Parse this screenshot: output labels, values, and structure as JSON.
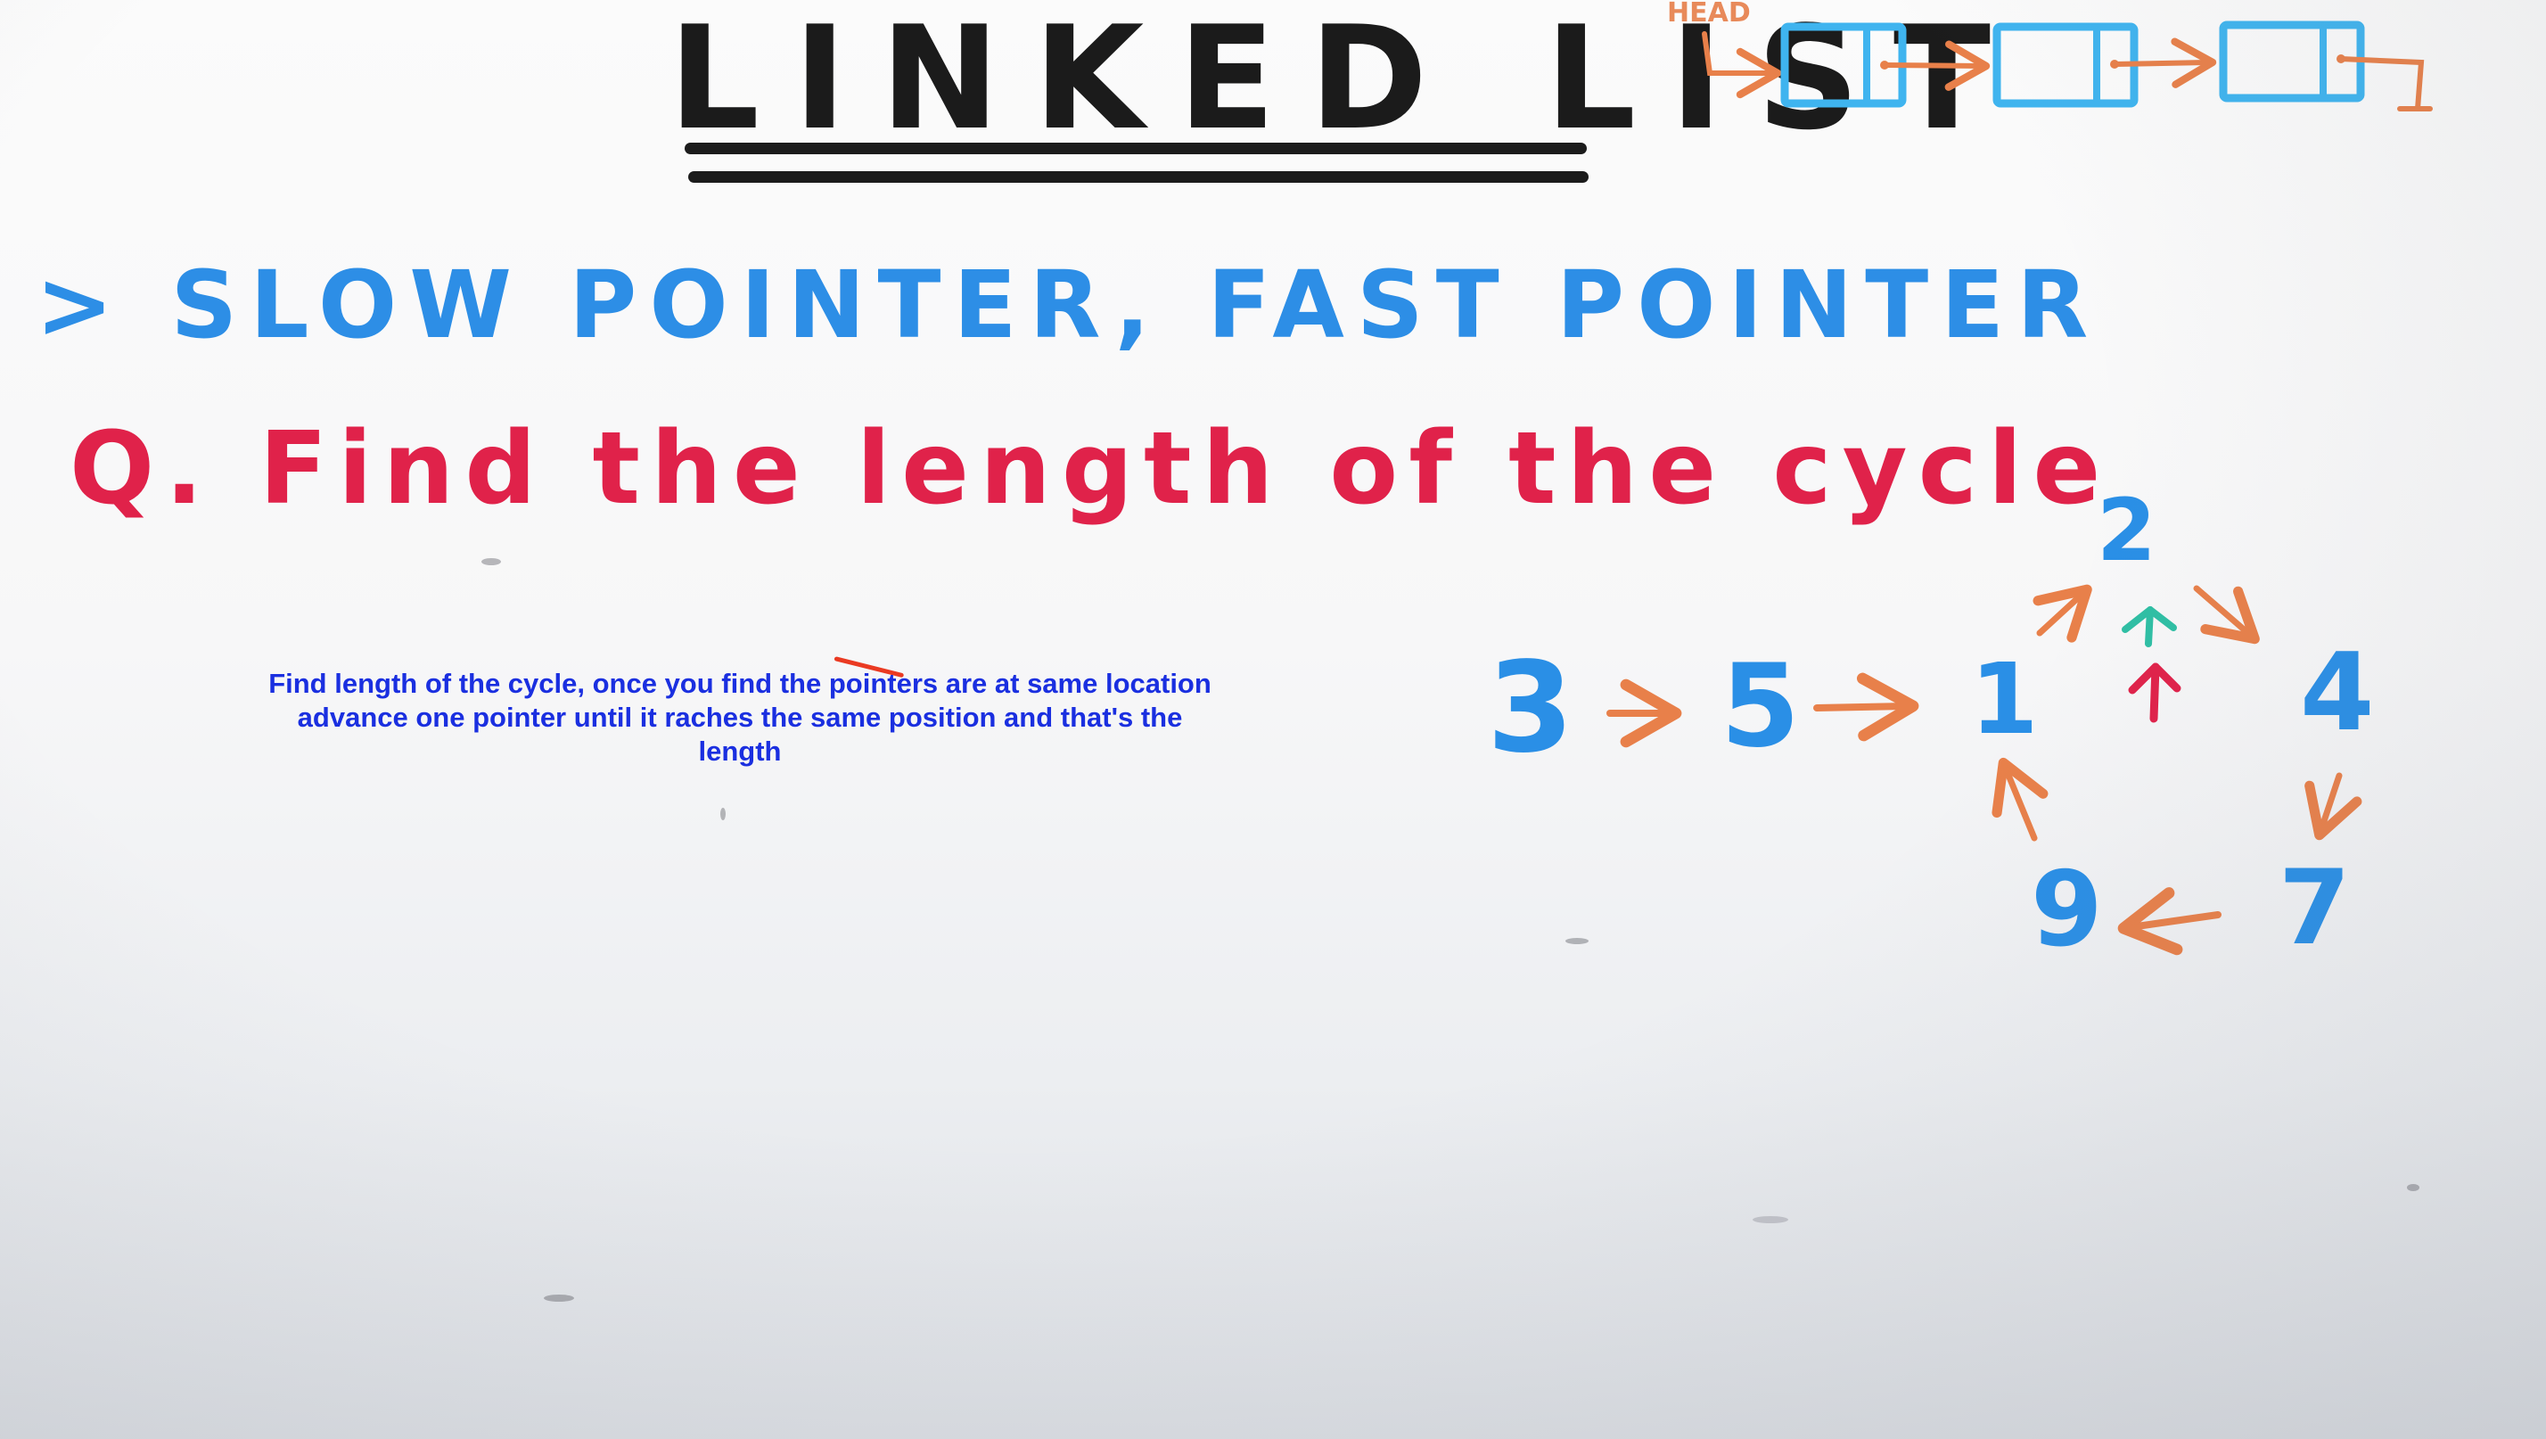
{
  "board": {
    "title": "LINKED LIST",
    "bullet": "> SLOW POINTER, FAST POINTER",
    "question": "Q. Find the length of the cycle"
  },
  "caption": {
    "text": "Find length of the cycle, once you find the pointers are at same location advance one pointer until it raches the same position and that's the length"
  },
  "header_diagram": {
    "head_label": "HEAD"
  },
  "cycle_diagram": {
    "nodes": [
      "3",
      "5",
      "1",
      "2",
      "4",
      "7",
      "9"
    ]
  },
  "colors": {
    "marker_black": "#1b1b1b",
    "marker_blue": "#2d8ee6",
    "marker_red": "#e0224a",
    "marker_orange": "#e8804a",
    "marker_green": "#2fbfa4",
    "caption_blue": "#1a2fe0",
    "box_cyan": "#3fb4ef"
  }
}
